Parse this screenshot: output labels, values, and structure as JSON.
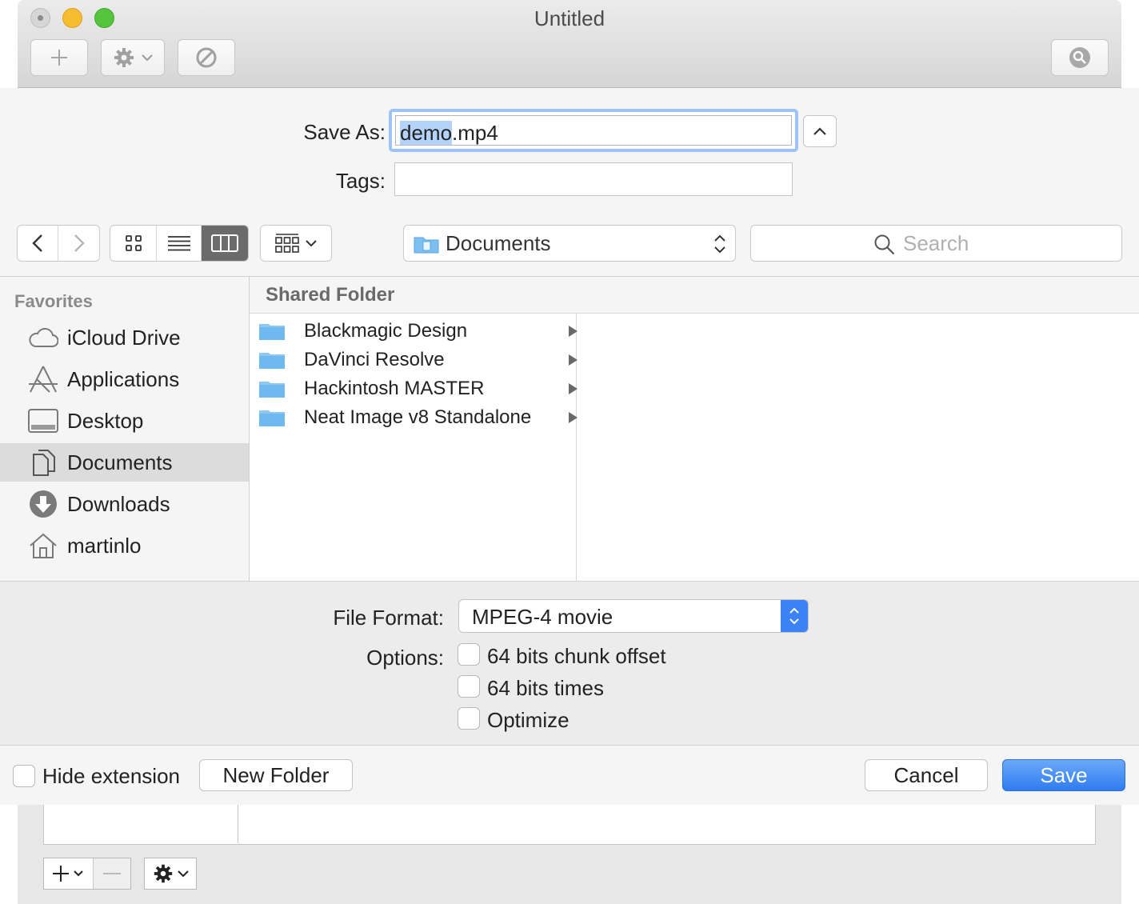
{
  "window": {
    "title": "Untitled",
    "traffic_colors": {
      "close": "#d0d0d0",
      "minimize": "#f5bd2f",
      "zoom": "#55c43e"
    }
  },
  "save_as": {
    "label": "Save As:",
    "value_selected": "demo",
    "value_rest": ".mp4"
  },
  "tags": {
    "label": "Tags:",
    "value": ""
  },
  "toolbar": {
    "location": "Documents",
    "search_placeholder": "Search"
  },
  "sidebar": {
    "heading": "Favorites",
    "items": [
      {
        "label": "iCloud Drive",
        "icon": "cloud-icon"
      },
      {
        "label": "Applications",
        "icon": "applications-icon"
      },
      {
        "label": "Desktop",
        "icon": "desktop-icon"
      },
      {
        "label": "Documents",
        "icon": "documents-icon",
        "selected": true
      },
      {
        "label": "Downloads",
        "icon": "downloads-icon"
      },
      {
        "label": "martinlo",
        "icon": "home-icon"
      }
    ]
  },
  "browser": {
    "column_header": "Shared Folder",
    "items": [
      {
        "name": "Blackmagic Design"
      },
      {
        "name": "DaVinci Resolve"
      },
      {
        "name": "Hackintosh MASTER"
      },
      {
        "name": "Neat Image v8 Standalone"
      }
    ]
  },
  "accessory": {
    "format_label": "File Format:",
    "format_value": "MPEG-4 movie",
    "options_label": "Options:",
    "options": [
      {
        "label": "64 bits chunk offset",
        "checked": false
      },
      {
        "label": "64 bits times",
        "checked": false
      },
      {
        "label": "Optimize",
        "checked": false
      }
    ]
  },
  "bottom": {
    "hide_extension_label": "Hide extension",
    "hide_extension_checked": false,
    "new_folder_label": "New Folder",
    "cancel_label": "Cancel",
    "save_label": "Save"
  },
  "colors": {
    "accent": "#3b82f6",
    "selection_text": "#b3d3fb",
    "sidebar_selected": "#dcdcdc",
    "folder_blue": "#6fb8f0"
  }
}
